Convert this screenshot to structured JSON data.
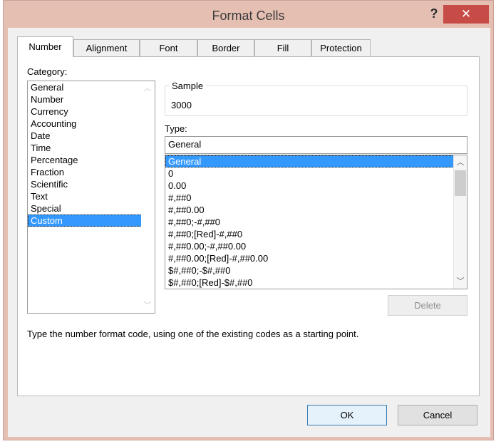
{
  "window": {
    "title": "Format Cells",
    "help_glyph": "?",
    "close_glyph": "✕"
  },
  "tabs": [
    {
      "label": "Number"
    },
    {
      "label": "Alignment"
    },
    {
      "label": "Font"
    },
    {
      "label": "Border"
    },
    {
      "label": "Fill"
    },
    {
      "label": "Protection"
    }
  ],
  "category": {
    "label": "Category:",
    "items": [
      "General",
      "Number",
      "Currency",
      "Accounting",
      "Date",
      "Time",
      "Percentage",
      "Fraction",
      "Scientific",
      "Text",
      "Special",
      "Custom"
    ],
    "selected": "Custom"
  },
  "sample": {
    "label": "Sample",
    "value": "3000"
  },
  "type": {
    "label": "Type:",
    "value": "General",
    "items": [
      "General",
      "0",
      "0.00",
      "#,##0",
      "#,##0.00",
      "#,##0;-#,##0",
      "#,##0;[Red]-#,##0",
      "#,##0.00;-#,##0.00",
      "#,##0.00;[Red]-#,##0.00",
      "$#,##0;-$#,##0",
      "$#,##0;[Red]-$#,##0"
    ],
    "selected": "General"
  },
  "buttons": {
    "delete": "Delete",
    "ok": "OK",
    "cancel": "Cancel"
  },
  "description": "Type the number format code, using one of the existing codes as a starting point.",
  "icons": {
    "scroll_up": "▲",
    "scroll_down": "▼"
  },
  "colors": {
    "selection": "#3399ff",
    "close_button": "#c74b46",
    "title_bar": "#e6bfb3"
  }
}
